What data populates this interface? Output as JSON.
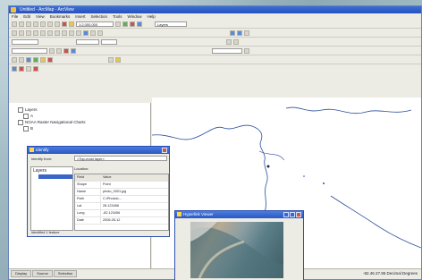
{
  "window": {
    "title": "Untitled - ArcMap - ArcView"
  },
  "menubar": {
    "items": [
      "File",
      "Edit",
      "View",
      "Bookmarks",
      "Insert",
      "Selection",
      "Tools",
      "Window",
      "Help"
    ]
  },
  "toolbar": {
    "scale_value": "1:2,000,000",
    "layer_combo": "Layers"
  },
  "toc": {
    "header": "Layers",
    "items": [
      "Layers",
      "A",
      "NOAA Raster Navigational Charts",
      "B"
    ]
  },
  "identify_window": {
    "title": "Identify",
    "identify_from_label": "Identify from:",
    "identify_from_value": "<Top-most layer>",
    "tree_root": "Layers",
    "tree_child": "",
    "location_label": "Location:",
    "columns": [
      "Field",
      "Value"
    ],
    "rows": [
      {
        "field": "Shape",
        "value": "Point"
      },
      {
        "field": "Name",
        "value": "photo_0001.jpg"
      },
      {
        "field": "Path",
        "value": "C:\\Photos\\..."
      },
      {
        "field": "Lat",
        "value": "28.123456"
      },
      {
        "field": "Long",
        "value": "-82.123456"
      },
      {
        "field": "Date",
        "value": "2006-05-12"
      }
    ],
    "status_text": "Identified 1 feature"
  },
  "hyperlink_window": {
    "title": "Hyperlink Viewer"
  },
  "status_bar": {
    "tabs": [
      "Display",
      "Source",
      "Selection"
    ],
    "coords": "-82.46  27.95 Decimal Degrees"
  },
  "colors": {
    "titlebar": "#2452b8",
    "accent": "#3b66c8",
    "map_line": "#2a4d9a"
  }
}
